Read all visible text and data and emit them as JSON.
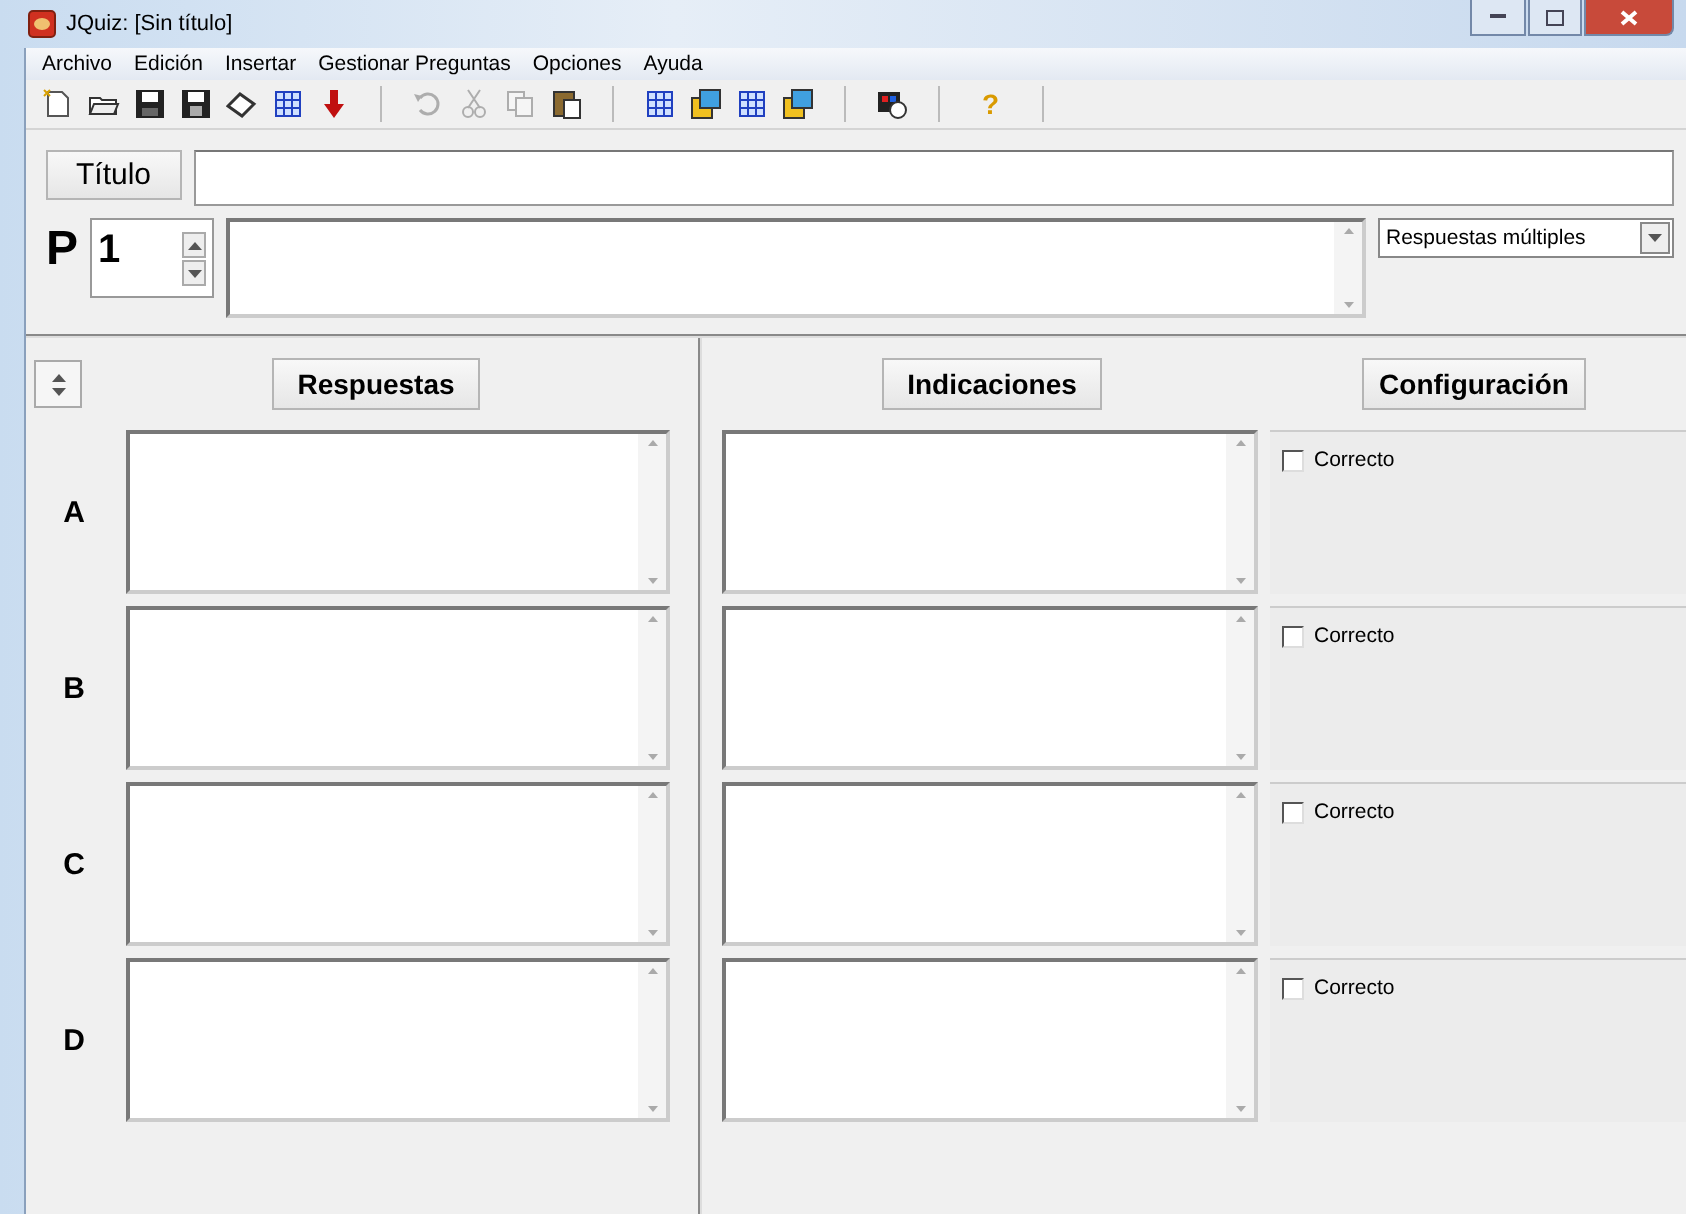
{
  "window": {
    "title": "JQuiz: [Sin título]"
  },
  "menu": [
    "Archivo",
    "Edición",
    "Insertar",
    "Gestionar Preguntas",
    "Opciones",
    "Ayuda"
  ],
  "toolbar": [
    {
      "kind": "icon",
      "disabled": false
    },
    {
      "kind": "icon",
      "disabled": false
    },
    {
      "kind": "icon",
      "disabled": false
    },
    {
      "kind": "icon",
      "disabled": false
    },
    {
      "kind": "icon",
      "disabled": false
    },
    {
      "kind": "icon",
      "disabled": false
    },
    {
      "kind": "icon",
      "disabled": false
    },
    {
      "kind": "separator"
    },
    {
      "kind": "icon",
      "disabled": true
    },
    {
      "kind": "icon",
      "disabled": true
    },
    {
      "kind": "icon",
      "disabled": true
    },
    {
      "kind": "icon",
      "disabled": false
    },
    {
      "kind": "separator"
    },
    {
      "kind": "icon",
      "disabled": false
    },
    {
      "kind": "icon",
      "disabled": false
    },
    {
      "kind": "icon",
      "disabled": false
    },
    {
      "kind": "icon",
      "disabled": false
    },
    {
      "kind": "separator"
    },
    {
      "kind": "icon",
      "disabled": false
    },
    {
      "kind": "separator"
    },
    {
      "kind": "text",
      "text": "?"
    },
    {
      "kind": "separator"
    }
  ],
  "title_button": "Título",
  "question": {
    "label": "P",
    "number": "1",
    "type": "Respuestas múltiples"
  },
  "headers": {
    "answers": "Respuestas",
    "feedback": "Indicaciones",
    "settings": "Configuración"
  },
  "answers": [
    {
      "letter": "A",
      "correct_label": "Correcto",
      "checked": false
    },
    {
      "letter": "B",
      "correct_label": "Correcto",
      "checked": false
    },
    {
      "letter": "C",
      "correct_label": "Correcto",
      "checked": false
    },
    {
      "letter": "D",
      "correct_label": "Correcto",
      "checked": false
    }
  ]
}
